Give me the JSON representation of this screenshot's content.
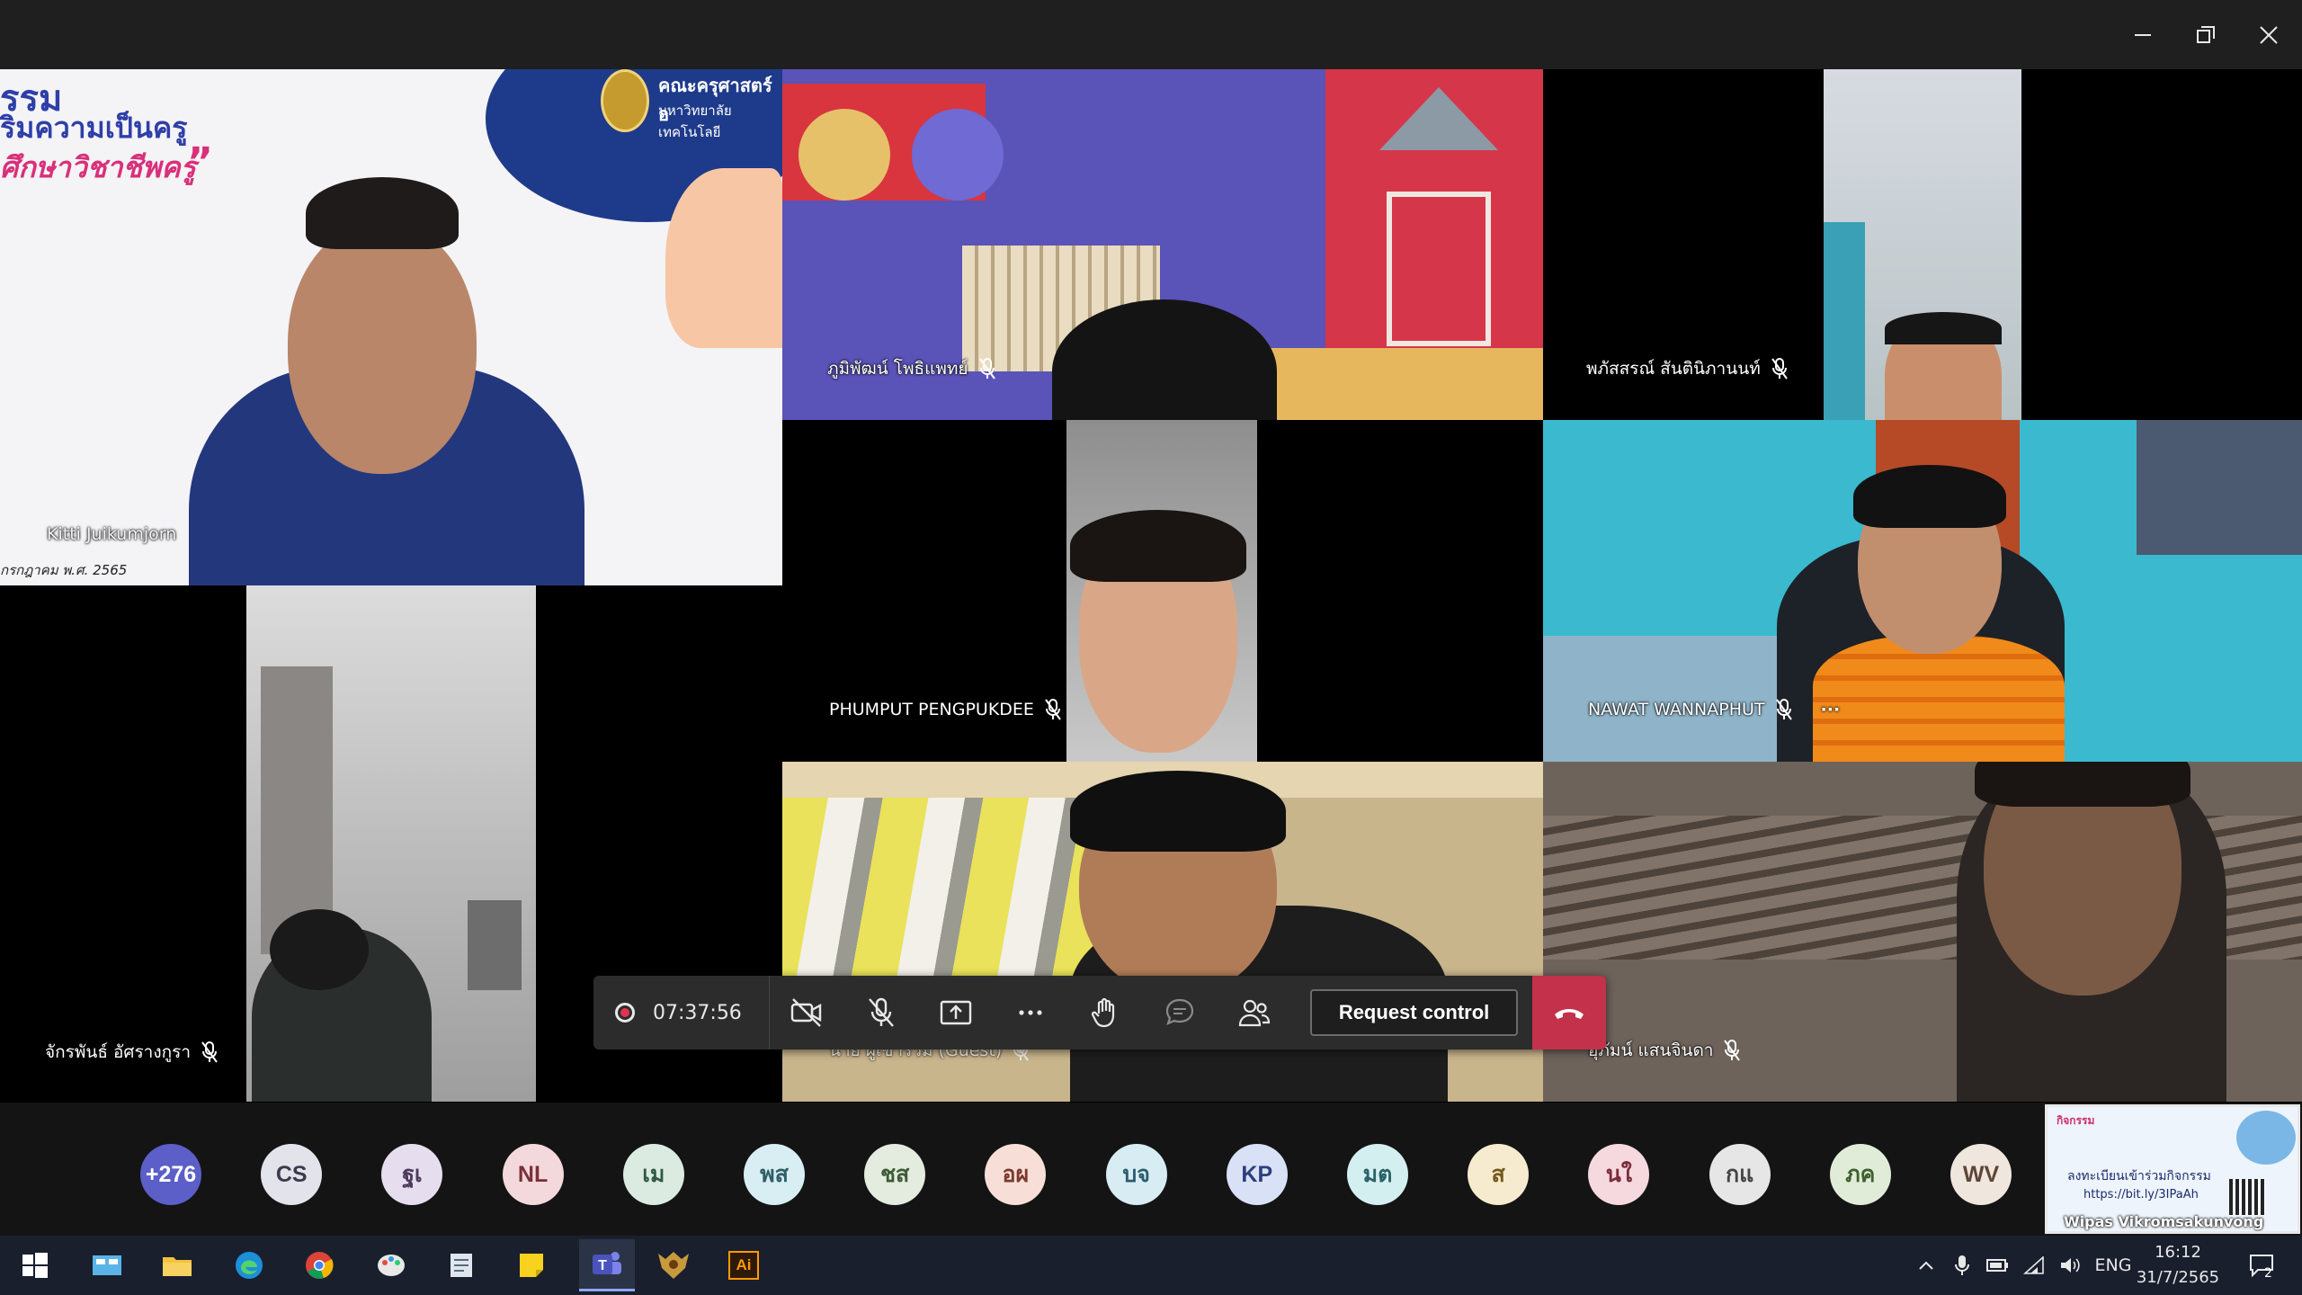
{
  "window": {
    "minimize_icon": "minimize-icon",
    "restore_icon": "restore-icon",
    "close_icon": "close-icon"
  },
  "tiles": {
    "presenter": {
      "name": "Kitti Juikumjorn",
      "banner_line1": "รรม",
      "banner_line2": "ริมความเป็นครู",
      "banner_line3": "ศึกษาวิชาชีพครู",
      "banner_date": "กรกฎาคม พ.ศ. 2565",
      "banner_faculty": "คณะครุศาสตร์อ",
      "banner_university": "มหาวิทยาลัยเทคโนโลยี"
    },
    "p1": {
      "name": "ภูมิพัฒน์ โพธิแพทย์",
      "muted": true
    },
    "p2": {
      "name": "พภัสสรณ์ สันตินิภานนท์",
      "muted": true
    },
    "p3": {
      "name": "PHUMPUT PENGPUKDEE",
      "muted": true
    },
    "p4": {
      "name": "NAWAT WANNAPHUT",
      "muted": true,
      "more": "···"
    },
    "p5": {
      "name": "จักรพันธ์ อัศรางกูรา",
      "muted": true
    },
    "p6": {
      "name": "นาย ผู้เข้าร่วม (Guest)",
      "muted": true
    },
    "p7": {
      "name": "อุภัมน์ แสนจินดา",
      "muted": true
    }
  },
  "controls": {
    "timer": "07:37:56",
    "request_control_label": "Request control",
    "icons": [
      "camera-off-icon",
      "mic-off-icon",
      "share-tray-icon",
      "more-icon",
      "raise-hand-icon",
      "chat-icon",
      "participants-icon",
      "hang-up-icon"
    ]
  },
  "participants_strip": {
    "avatars": [
      {
        "label": "+276",
        "bg": "#5b5fc7",
        "fg": "#ffffff"
      },
      {
        "label": "CS",
        "bg": "#e3e3ec",
        "fg": "#3b3b4f"
      },
      {
        "label": "ฐเ",
        "bg": "#e6ddee",
        "fg": "#4a3b5c"
      },
      {
        "label": "NL",
        "bg": "#f4d9dc",
        "fg": "#7a2f3a"
      },
      {
        "label": "เม",
        "bg": "#dcebe2",
        "fg": "#2f5a42"
      },
      {
        "label": "พส",
        "bg": "#d8eef2",
        "fg": "#2f5f68"
      },
      {
        "label": "ชส",
        "bg": "#e3ecdf",
        "fg": "#3f5a36"
      },
      {
        "label": "อผ",
        "bg": "#f7dfd8",
        "fg": "#7a3b2c"
      },
      {
        "label": "บจ",
        "bg": "#d7ecf3",
        "fg": "#2b5d70"
      },
      {
        "label": "KP",
        "bg": "#d9e1f7",
        "fg": "#2c3f7a"
      },
      {
        "label": "มต",
        "bg": "#d4eff0",
        "fg": "#2a6266"
      },
      {
        "label": "ส",
        "bg": "#f7ebcf",
        "fg": "#74591d"
      },
      {
        "label": "นใ",
        "bg": "#f6d9de",
        "fg": "#7b2d3c"
      },
      {
        "label": "กแ",
        "bg": "#e6e6e6",
        "fg": "#444444"
      },
      {
        "label": "ภค",
        "bg": "#e0ecd8",
        "fg": "#40602e"
      },
      {
        "label": "WV",
        "bg": "#efe6de",
        "fg": "#5d4636"
      }
    ],
    "share_thumbnail": {
      "presenter": "Wipas Vikromsakunvong",
      "header": "กิจกรรม",
      "text": "ลงทะเบียนเข้าร่วมกิจกรรม",
      "link": "https://bit.ly/3IPaAh"
    }
  },
  "taskbar": {
    "icons": [
      "windows-start-icon",
      "task-view-icon",
      "file-explorer-icon",
      "edge-icon",
      "chrome-icon",
      "paint-icon",
      "notepad-icon",
      "sticky-notes-icon",
      "teams-icon",
      "game-icon",
      "illustrator-icon"
    ],
    "illustrator_label": "Ai",
    "language": "ENG",
    "time": "16:12",
    "date": "31/7/2565",
    "notification_count": "2"
  }
}
